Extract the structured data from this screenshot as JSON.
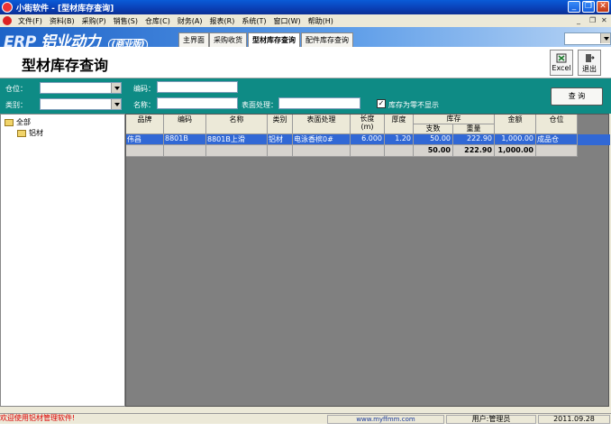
{
  "window": {
    "title": "小街软件 - [型材库存查询]"
  },
  "menu": [
    "文件(F)",
    "资料(B)",
    "采购(P)",
    "销售(S)",
    "仓库(C)",
    "财务(A)",
    "报表(R)",
    "系统(T)",
    "窗口(W)",
    "帮助(H)"
  ],
  "brand": {
    "erp": "ERP",
    "name": "铝业动力",
    "edition": "(商业版)"
  },
  "tabs": [
    "主界面",
    "采购收货",
    "型材库存查询",
    "配件库存查询"
  ],
  "page": {
    "title": "型材库存查询"
  },
  "toolbar": {
    "excel": "Excel",
    "exit": "退出"
  },
  "filters": {
    "warehouse_label": "仓位：",
    "category_label": "类别：",
    "code_label": "编码：",
    "name_label": "名称：",
    "surface_label": "表面处理：",
    "zero_stock_label": "库存为零不显示",
    "zero_stock_checked": true,
    "query_button": "查 询"
  },
  "tree": {
    "root": "全部",
    "child": "铝材"
  },
  "grid": {
    "headers": [
      "品牌",
      "编码",
      "名称",
      "类别",
      "表面处理",
      "长度\n(m)",
      "厚度",
      "库存",
      "金额",
      "仓位"
    ],
    "sub_headers": [
      "支数",
      "重量"
    ],
    "rows": [
      [
        "伟昌",
        "8801B",
        "8801B上滑",
        "铝材",
        "电泳香槟0#",
        "6.000",
        "1.20",
        "50.00",
        "222.90",
        "1,000.00",
        "成品仓"
      ]
    ],
    "totals": {
      "count": "50.00",
      "weight": "222.90",
      "amount": "1,000.00"
    }
  },
  "status": {
    "welcome": "欢迎使用铝材管理软件!",
    "website": "www.myffmm.com",
    "user": "用户:管理员",
    "date": "2011.09.28"
  },
  "colors": {
    "filter_bg": "#0e8b85",
    "selected_row": "#3168d5",
    "grid_bg": "#808080",
    "title_bar": "#0a5bd8"
  }
}
